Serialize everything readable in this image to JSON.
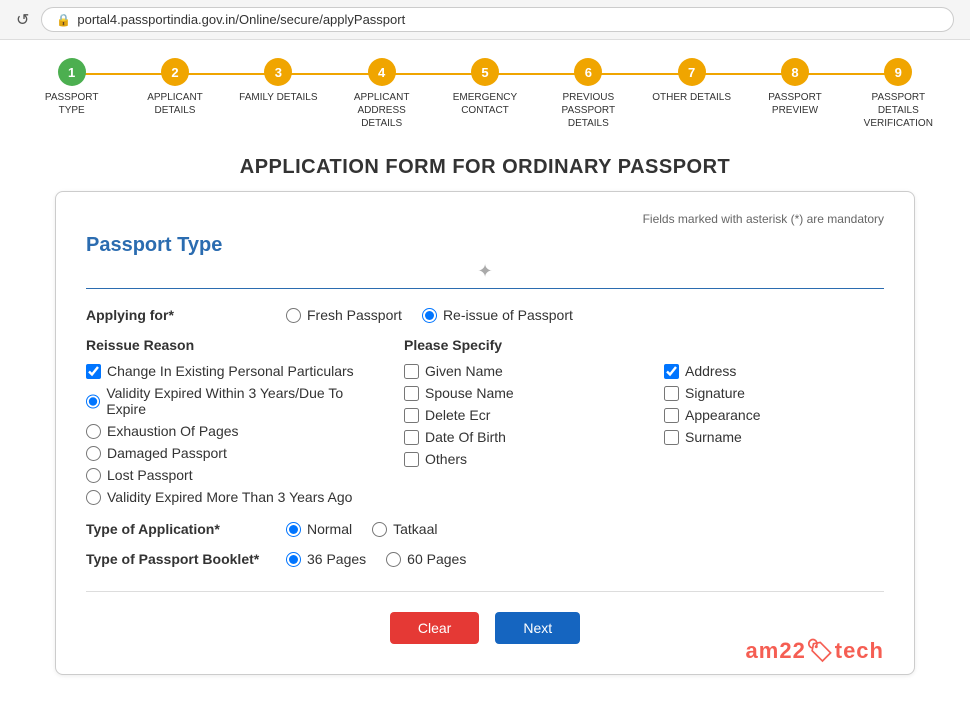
{
  "browser": {
    "url": "portal4.passportindia.gov.in/Online/secure/applyPassport",
    "refresh_icon": "↺",
    "lock_icon": "🔒"
  },
  "stepper": {
    "steps": [
      {
        "number": "1",
        "label": "PASSPORT TYPE",
        "state": "active"
      },
      {
        "number": "2",
        "label": "APPLICANT DETAILS",
        "state": "pending"
      },
      {
        "number": "3",
        "label": "FAMILY DETAILS",
        "state": "pending"
      },
      {
        "number": "4",
        "label": "APPLICANT ADDRESS DETAILS",
        "state": "pending"
      },
      {
        "number": "5",
        "label": "EMERGENCY CONTACT",
        "state": "pending"
      },
      {
        "number": "6",
        "label": "PREVIOUS PASSPORT DETAILS",
        "state": "pending"
      },
      {
        "number": "7",
        "label": "OTHER DETAILS",
        "state": "pending"
      },
      {
        "number": "8",
        "label": "PASSPORT PREVIEW",
        "state": "pending"
      },
      {
        "number": "9",
        "label": "PASSPORT DETAILS VERIFICATION",
        "state": "pending"
      }
    ]
  },
  "page": {
    "title": "APPLICATION FORM FOR ORDINARY PASSPORT",
    "mandatory_note": "Fields marked with asterisk (*) are mandatory"
  },
  "form": {
    "section_title": "Passport Type",
    "applying_for_label": "Applying for",
    "applying_for_required": "*",
    "applying_options": [
      {
        "id": "fresh",
        "label": "Fresh Passport",
        "checked": false
      },
      {
        "id": "reissue",
        "label": "Re-issue of Passport",
        "checked": true
      }
    ],
    "reissue_reason_label": "Reissue Reason",
    "reissue_reasons": [
      {
        "id": "change_personal",
        "label": "Change In Existing Personal Particulars",
        "type": "checkbox",
        "checked": true
      },
      {
        "id": "validity_within3",
        "label": "Validity Expired Within 3 Years/Due To Expire",
        "type": "radio",
        "checked": true
      },
      {
        "id": "exhaustion_pages",
        "label": "Exhaustion Of Pages",
        "type": "radio",
        "checked": false
      },
      {
        "id": "damaged_passport",
        "label": "Damaged Passport",
        "type": "radio",
        "checked": false
      },
      {
        "id": "lost_passport",
        "label": "Lost Passport",
        "type": "radio",
        "checked": false
      },
      {
        "id": "validity_more3",
        "label": "Validity Expired More Than 3 Years Ago",
        "type": "radio",
        "checked": false
      }
    ],
    "please_specify_label": "Please Specify",
    "specify_items": [
      {
        "id": "given_name",
        "label": "Given Name",
        "checked": false
      },
      {
        "id": "address",
        "label": "Address",
        "checked": true
      },
      {
        "id": "spouse_name",
        "label": "Spouse Name",
        "checked": false
      },
      {
        "id": "signature",
        "label": "Signature",
        "checked": false
      },
      {
        "id": "delete_ecr",
        "label": "Delete Ecr",
        "checked": false
      },
      {
        "id": "appearance",
        "label": "Appearance",
        "checked": false
      },
      {
        "id": "date_of_birth",
        "label": "Date Of Birth",
        "checked": false
      },
      {
        "id": "surname",
        "label": "Surname",
        "checked": false
      },
      {
        "id": "others",
        "label": "Others",
        "checked": false
      }
    ],
    "type_of_application_label": "Type of Application",
    "type_of_application_required": "*",
    "application_types": [
      {
        "id": "normal",
        "label": "Normal",
        "checked": true
      },
      {
        "id": "tatkaal",
        "label": "Tatkaal",
        "checked": false
      }
    ],
    "type_of_booklet_label": "Type of Passport Booklet",
    "type_of_booklet_required": "*",
    "booklet_types": [
      {
        "id": "36pages",
        "label": "36 Pages",
        "checked": true
      },
      {
        "id": "60pages",
        "label": "60 Pages",
        "checked": false
      }
    ],
    "buttons": {
      "clear": "Clear",
      "next": "Next"
    }
  },
  "watermark": {
    "text_before": "am22",
    "icon": "🏷",
    "text_after": "tech"
  }
}
